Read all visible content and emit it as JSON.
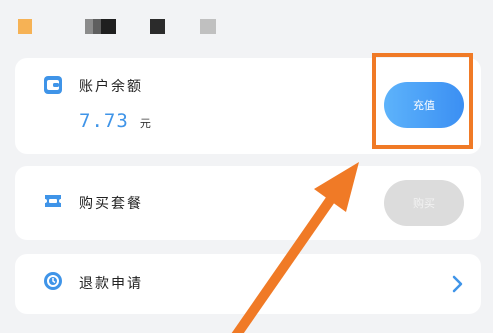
{
  "status_bar": {},
  "balance_card": {
    "title": "账户余额",
    "amount": "7.73",
    "unit": "元",
    "recharge_label": "充值",
    "icon": "wallet-icon"
  },
  "package_card": {
    "title": "购买套餐",
    "button_label": "购买",
    "icon": "ticket-icon"
  },
  "refund_card": {
    "title": "退款申请",
    "icon": "refund-icon",
    "chevron": "chevron-right-icon"
  },
  "annotation": {
    "color": "#f07a26"
  },
  "colors": {
    "accent": "#3f94e8",
    "disabled": "#dcdcdc",
    "highlight": "#f07a26"
  }
}
